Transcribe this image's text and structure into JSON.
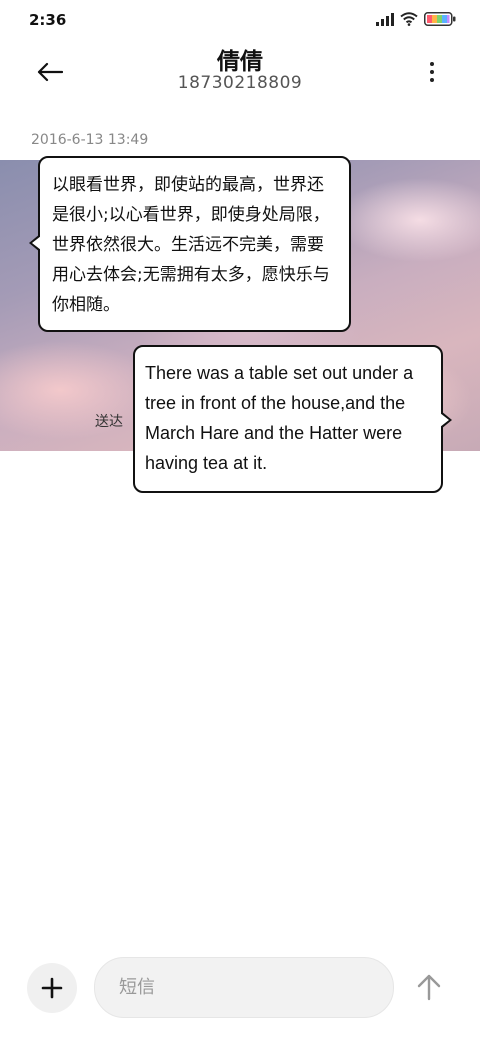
{
  "status_bar": {
    "time": "2:36",
    "icons": [
      "signal-icon",
      "wifi-icon",
      "battery-icon"
    ]
  },
  "header": {
    "contact_name": "倩倩",
    "contact_number": "18730218809",
    "icons": [
      "back-arrow-icon",
      "more-vertical-icon"
    ]
  },
  "conversation": {
    "timestamp": "2016-6-13 13:49",
    "messages": [
      {
        "direction": "incoming",
        "text": "以眼看世界，即使站的最高，世界还是很小;以心看世界，即使身处局限，世界依然很大。生活远不完美，需要用心去体会;无需拥有太多，愿快乐与你相随。"
      },
      {
        "direction": "outgoing",
        "text": "There was a table set out under a tree in front of the house,and the March Hare and the Hatter were having tea at it.",
        "status": "送达"
      }
    ]
  },
  "composer": {
    "placeholder": "短信",
    "value": "",
    "icons": [
      "plus-icon",
      "send-arrow-icon"
    ]
  },
  "colors": {
    "bubble_border": "#111111",
    "bubble_fill": "#ffffff",
    "input_bg": "#f2f2f2"
  }
}
